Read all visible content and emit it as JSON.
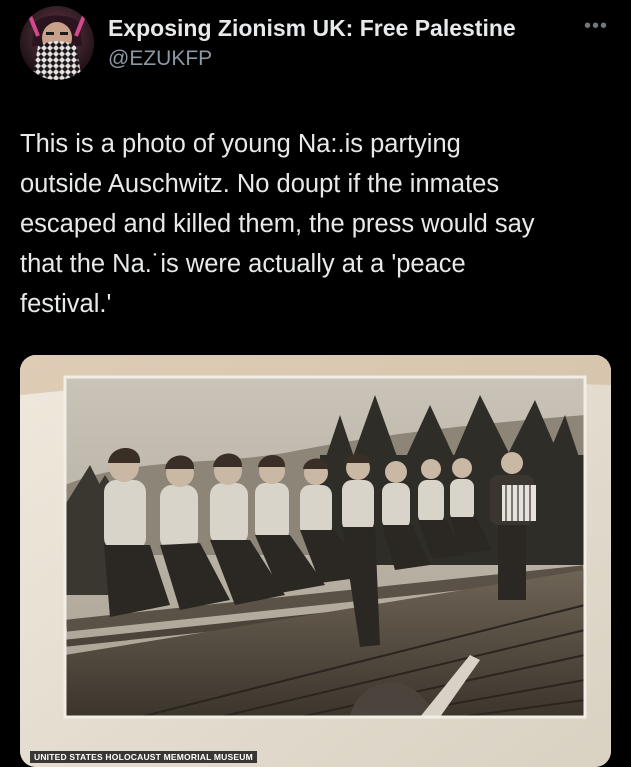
{
  "header": {
    "display_name": "Exposing Zionism UK: Free Palestine",
    "handle": "@EZUKFP",
    "more_icon": "more-horizontal-icon"
  },
  "tweet": {
    "text": "This is a photo of young Na:.is partying\noutside Auschwitz. No doupt if the inmates\nescaped and killed them, the press would say\nthat the Na.˙is were actually at a 'peace\nfestival.'"
  },
  "media": {
    "watermark": "UNITED STATES HOLOCAUST MEMORIAL MUSEUM"
  }
}
